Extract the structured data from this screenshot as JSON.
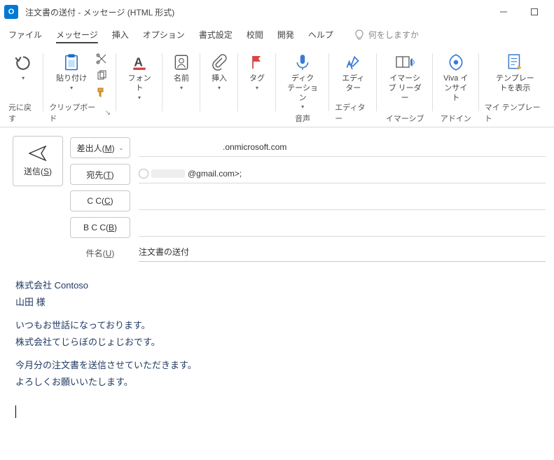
{
  "titlebar": {
    "app_initials": "O",
    "title": "注文書の送付 - メッセージ (HTML 形式)"
  },
  "menubar": {
    "items": [
      {
        "label": "ファイル"
      },
      {
        "label": "メッセージ"
      },
      {
        "label": "挿入"
      },
      {
        "label": "オプション"
      },
      {
        "label": "書式設定"
      },
      {
        "label": "校閲"
      },
      {
        "label": "開発"
      },
      {
        "label": "ヘルプ"
      }
    ],
    "tell_me": "何をしますか"
  },
  "ribbon": {
    "undo": {
      "label": "元に戻す",
      "group": "元に戻す"
    },
    "clipboard": {
      "paste": "貼り付け",
      "group": "クリップボード"
    },
    "font": {
      "label": "フォント"
    },
    "names": {
      "label": "名前"
    },
    "insert": {
      "label": "挿入"
    },
    "tag": {
      "label": "タグ"
    },
    "dictation": {
      "label": "ディク\nテーション",
      "group": "音声"
    },
    "editor": {
      "label": "エディ\nター",
      "group": "エディター"
    },
    "immersive": {
      "label": "イマーシ\nブ リーダー",
      "group": "イマーシブ"
    },
    "viva": {
      "label": "Viva イ\nンサイト",
      "group": "アドイン"
    },
    "template": {
      "label": "テンプレー\nトを表示",
      "group": "マイ テンプレート"
    }
  },
  "compose": {
    "send": "送信(S)",
    "from_label": "差出人(M)",
    "from_value": ".onmicrosoft.com",
    "to_label": "宛先(T)",
    "to_value": "@gmail.com>;",
    "cc_label": "C C(C)",
    "bcc_label": "B C C(B)",
    "subject_label": "件名(U)",
    "subject_value": "注文書の送付"
  },
  "body": {
    "l1": "株式会社 Contoso",
    "l2": "山田 様",
    "l3": "いつもお世話になっております。",
    "l4": "株式会社てじらぼのじょじおです。",
    "l5": "今月分の注文書を送信させていただきます。",
    "l6": "よろしくお願いいたします。"
  }
}
